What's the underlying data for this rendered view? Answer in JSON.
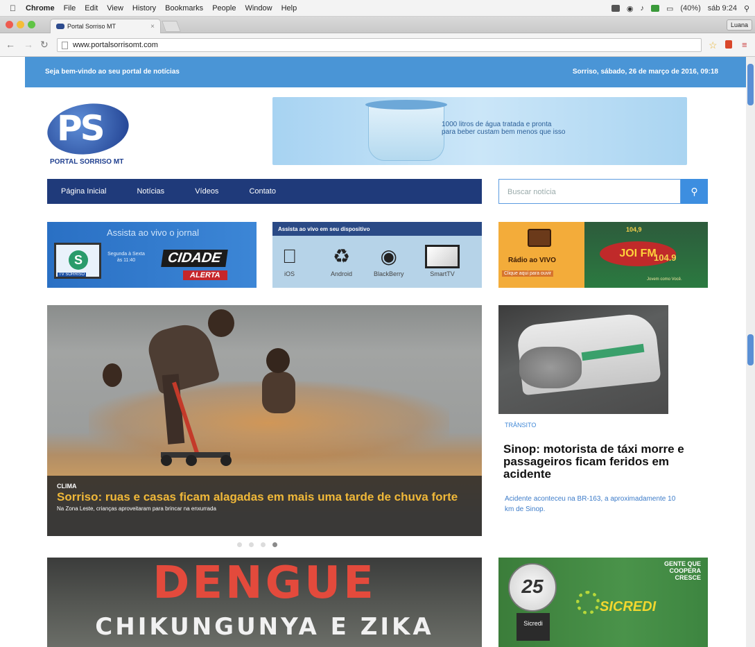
{
  "menubar": {
    "app": "Chrome",
    "items": [
      "File",
      "Edit",
      "View",
      "History",
      "Bookmarks",
      "People",
      "Window",
      "Help"
    ],
    "battery": "(40%)",
    "clock": "sáb 9:24"
  },
  "browser": {
    "tab_title": "Portal Sorriso MT",
    "user": "Luana",
    "url": "www.portalsorrisomt.com"
  },
  "page": {
    "welcome": "Seja bem-vindo ao seu portal de notícias",
    "date": "Sorriso, sábado, 26 de março de 2016, 09:18",
    "logo_name": "PORTAL SORRISO MT",
    "banner_line1": "1000 litros de água tratada e pronta",
    "banner_line2": "para beber custam bem menos que isso",
    "nav": [
      "Página Inicial",
      "Notícias",
      "Vídeos",
      "Contato"
    ],
    "search_placeholder": "Buscar notícia",
    "promo1": {
      "head": "Assista ao vivo o jornal",
      "tv_label": "TV SORRISO",
      "schedule1": "Segunda à Sexta",
      "schedule2": "às 11:40",
      "cidade": "CIDADE",
      "alerta": "ALERTA"
    },
    "promo2": {
      "head": "Assista ao vivo em seu dispositivo",
      "devices": [
        "iOS",
        "Android",
        "BlackBerry",
        "SmartTV"
      ]
    },
    "promo3": {
      "label": "Rádio ao VIVO",
      "sub": "Clique aqui para ouvir",
      "freq": "104,9",
      "fm": "JOI FM",
      "fm_num": "104.9",
      "slogan": "Jovem como Você."
    },
    "hero": {
      "category": "CLIMA",
      "title": "Sorriso: ruas e casas ficam alagadas em mais uma tarde de chuva forte",
      "subtitle": "Na Zona Leste, crianças aproveitaram para brincar na enxurrada"
    },
    "side": {
      "category": "TRÂNSITO",
      "title": "Sinop: motorista de táxi morre e passageiros ficam feridos em acidente",
      "subtitle": "Acidente aconteceu na BR-163, a aproximadamente 10 km de Sinop."
    },
    "dengue": {
      "line1": "DENGUE",
      "line2": "CHIKUNGUNYA E ZIKA"
    },
    "sicredi": {
      "years": "25",
      "badge": "Sicredi",
      "slogan": "GENTE QUE COOPERA CRESCE",
      "brand": "SICREDI"
    }
  },
  "colors": {
    "accent_blue": "#4a95d6",
    "nav_navy": "#1f3a7a",
    "headline_gold": "#f0b839"
  }
}
